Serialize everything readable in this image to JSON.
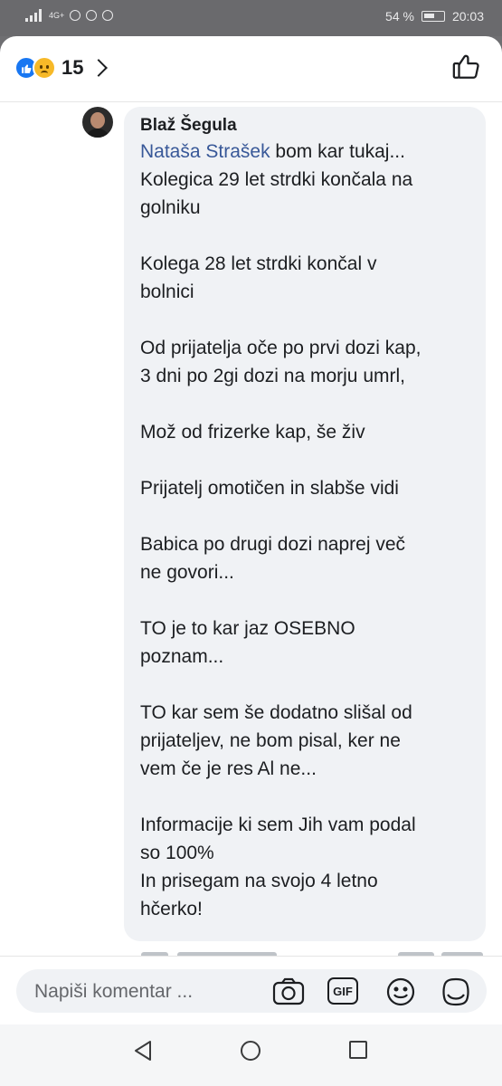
{
  "status_bar": {
    "network": "4G+",
    "battery_percent": "54 %",
    "time": "20:03",
    "icons": [
      "signal-icon",
      "eye-icon",
      "alarm-icon",
      "do-not-disturb-icon",
      "battery-icon"
    ]
  },
  "header": {
    "reaction_icons": [
      "like-reaction-icon",
      "sad-reaction-icon"
    ],
    "reaction_count": "15",
    "chevron_icon": "chevron-right-icon",
    "like_button_icon": "thumbs-up-icon"
  },
  "comment": {
    "author": "Blaž Šegula",
    "mention": "Nataša Strašek",
    "lines": [
      " bom kar tukaj...",
      "Kolegica 29 let strdki končala na",
      "golniku",
      "",
      "Kolega 28 let strdki končal v",
      "bolnici",
      "",
      "Od prijatelja oče po prvi dozi kap,",
      "3 dni po 2gi dozi na morju umrl,",
      "",
      "Mož od frizerke kap, še živ",
      "",
      "Prijatelj omotičen in slabše vidi",
      "",
      "Babica po drugi dozi naprej več",
      "ne govori...",
      "",
      "TO je to kar jaz OSEBNO",
      "poznam...",
      "",
      "TO kar sem še dodatno slišal od",
      "prijateljev, ne bom pisal, ker ne",
      "vem če je res Al ne...",
      "",
      "Informacije ki sem Jih vam podal",
      "so 100%",
      "In prisegam na svojo 4 letno",
      "hčerko!"
    ]
  },
  "composer": {
    "placeholder": "Napiši komentar ...",
    "icons": [
      "camera-icon",
      "gif-icon",
      "emoji-icon",
      "sticker-icon"
    ],
    "gif_label": "GIF"
  },
  "nav": {
    "icons": [
      "back-icon",
      "home-icon",
      "recents-icon"
    ]
  },
  "colors": {
    "accent": "#1877f2",
    "mention": "#385898",
    "bubble": "#f0f2f5"
  }
}
